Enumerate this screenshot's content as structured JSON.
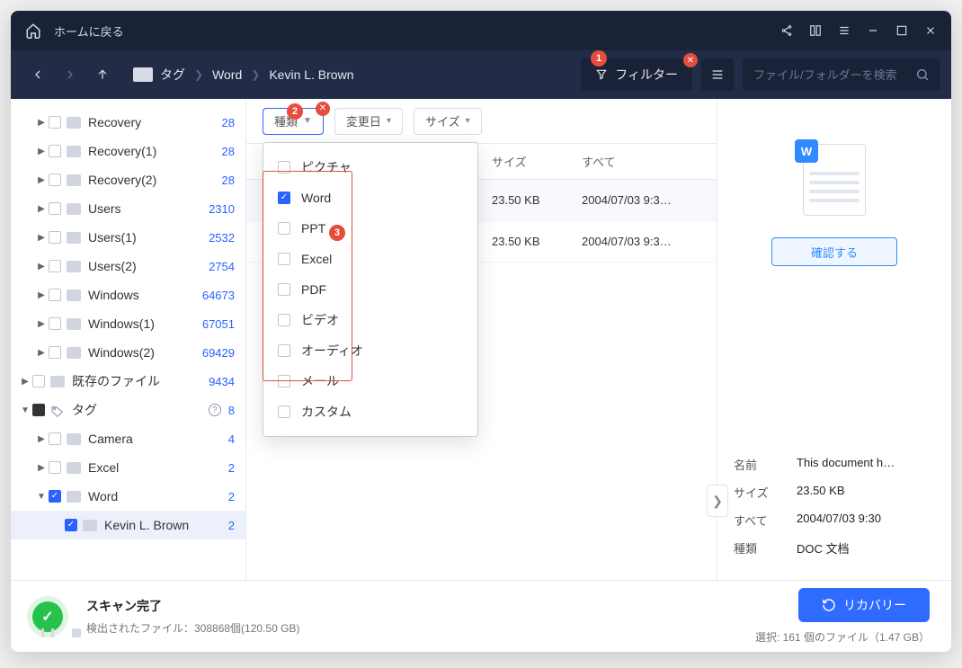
{
  "titlebar": {
    "home_label": "ホームに戻る"
  },
  "navbar": {
    "crumb_root": "タグ",
    "crumbs": [
      "Word",
      "Kevin L. Brown"
    ],
    "filter_label": "フィルター",
    "search_placeholder": "ファイル/フォルダーを検索"
  },
  "toolbar": {
    "type_label": "種類",
    "date_label": "変更日",
    "size_label": "サイズ"
  },
  "table": {
    "col_size": "サイズ",
    "col_all": "すべて",
    "rows": [
      {
        "size": "23.50 KB",
        "date": "2004/07/03 9:3…"
      },
      {
        "size": "23.50 KB",
        "date": "2004/07/03 9:3…"
      }
    ]
  },
  "sidebar": {
    "items": [
      {
        "label": "Recovery",
        "count": "28",
        "indent": 1,
        "arrow": "▶",
        "cb": ""
      },
      {
        "label": "Recovery(1)",
        "count": "28",
        "indent": 1,
        "arrow": "▶",
        "cb": ""
      },
      {
        "label": "Recovery(2)",
        "count": "28",
        "indent": 1,
        "arrow": "▶",
        "cb": ""
      },
      {
        "label": "Users",
        "count": "2310",
        "indent": 1,
        "arrow": "▶",
        "cb": ""
      },
      {
        "label": "Users(1)",
        "count": "2532",
        "indent": 1,
        "arrow": "▶",
        "cb": ""
      },
      {
        "label": "Users(2)",
        "count": "2754",
        "indent": 1,
        "arrow": "▶",
        "cb": ""
      },
      {
        "label": "Windows",
        "count": "64673",
        "indent": 1,
        "arrow": "▶",
        "cb": ""
      },
      {
        "label": "Windows(1)",
        "count": "67051",
        "indent": 1,
        "arrow": "▶",
        "cb": ""
      },
      {
        "label": "Windows(2)",
        "count": "69429",
        "indent": 1,
        "arrow": "▶",
        "cb": ""
      },
      {
        "label": "既存のファイル",
        "count": "9434",
        "indent": 0,
        "arrow": "▶",
        "cb": ""
      },
      {
        "label": "タグ",
        "count": "8",
        "indent": 0,
        "arrow": "▼",
        "cb": "square",
        "tag": true,
        "help": true
      },
      {
        "label": "Camera",
        "count": "4",
        "indent": 1,
        "arrow": "▶",
        "cb": ""
      },
      {
        "label": "Excel",
        "count": "2",
        "indent": 1,
        "arrow": "▶",
        "cb": ""
      },
      {
        "label": "Word",
        "count": "2",
        "indent": 1,
        "arrow": "▼",
        "cb": "chk"
      },
      {
        "label": "Kevin L. Brown",
        "count": "2",
        "indent": 2,
        "arrow": "",
        "cb": "chk",
        "active": true
      }
    ]
  },
  "dropdown": {
    "items": [
      {
        "label": "ピクチャ",
        "checked": false
      },
      {
        "label": "Word",
        "checked": true
      },
      {
        "label": "PPT",
        "checked": false
      },
      {
        "label": "Excel",
        "checked": false
      },
      {
        "label": "PDF",
        "checked": false
      },
      {
        "label": "ビデオ",
        "checked": false
      },
      {
        "label": "オーディオ",
        "checked": false
      },
      {
        "label": "メール",
        "checked": false
      },
      {
        "label": "カスタム",
        "checked": false
      }
    ]
  },
  "details": {
    "confirm_label": "確認する",
    "rows": [
      {
        "k": "名前",
        "v": "This document h…"
      },
      {
        "k": "サイズ",
        "v": "23.50 KB"
      },
      {
        "k": "すべて",
        "v": "2004/07/03 9:30"
      },
      {
        "k": "種類",
        "v": "DOC 文档"
      }
    ],
    "icon_letter": "W"
  },
  "footer": {
    "title": "スキャン完了",
    "subtitle": "検出されたファイル：308868個(120.50 GB)",
    "recover_label": "リカバリー",
    "selection": "選択: 161 個のファイル（1.47 GB）"
  },
  "badges": {
    "b1": "1",
    "b2": "2",
    "b3": "3"
  }
}
